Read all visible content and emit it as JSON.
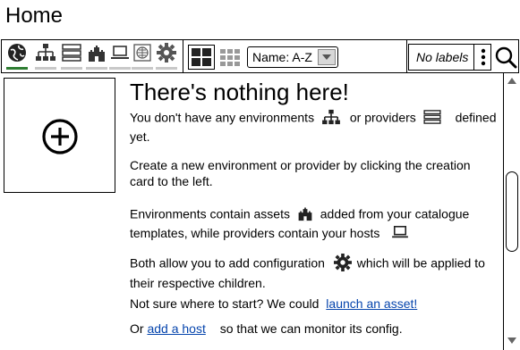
{
  "page": {
    "title": "Home"
  },
  "toolbar": {
    "tabs": [
      {
        "icon": "globe-icon",
        "active": true
      },
      {
        "icon": "hierarchy-icon",
        "active": false
      },
      {
        "icon": "server-icon",
        "active": false
      },
      {
        "icon": "castle-icon",
        "active": false
      },
      {
        "icon": "laptop-icon",
        "active": false
      },
      {
        "icon": "globe-grid-icon",
        "active": false
      },
      {
        "icon": "gear-icon",
        "active": false
      }
    ],
    "sort_value": "Name: A-Z",
    "labels_value": "No labels"
  },
  "empty_state": {
    "title": "There's nothing here!",
    "p1_a": "You don't have any environments",
    "p1_b": "or providers",
    "p1_c": "defined",
    "p1_d": "yet.",
    "p2": "Create a new environment or provider by clicking the creation card to the left.",
    "p3_a": "Environments contain assets",
    "p3_b": "added from your catalogue templates, while providers contain your hosts",
    "p4_a": "Both allow you to add configuration",
    "p4_b": "which will be applied to their respective children.",
    "p5_text": "Not sure where to start? We could",
    "p5_link": "launch an asset!",
    "p6_prefix": "Or",
    "p6_link": "add a host",
    "p6_suffix": "so that we can monitor its config."
  },
  "colors": {
    "link": "#0645ad",
    "active_tab": "#2e7d32"
  }
}
